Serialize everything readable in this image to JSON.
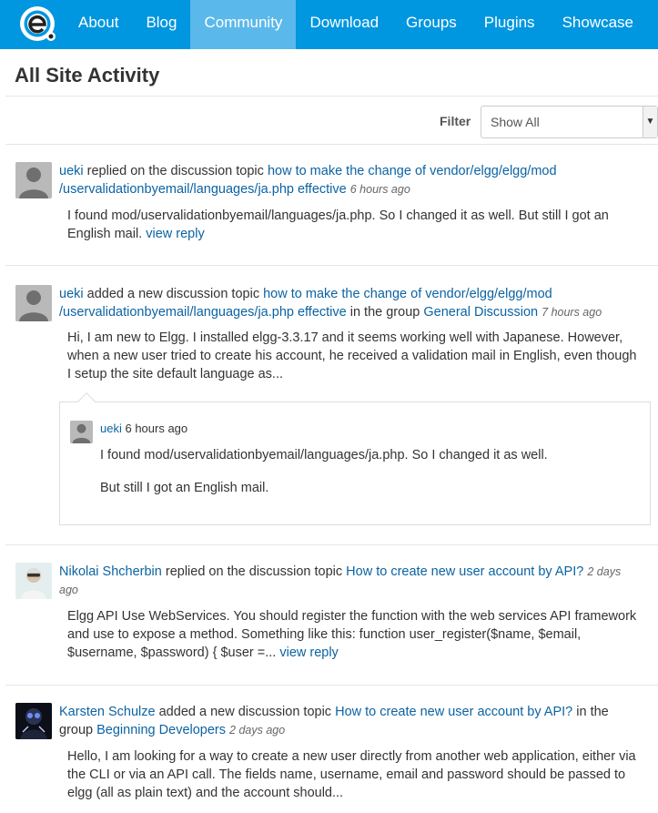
{
  "nav": {
    "items": [
      {
        "label": "About"
      },
      {
        "label": "Blog"
      },
      {
        "label": "Community",
        "active": true
      },
      {
        "label": "Download"
      },
      {
        "label": "Groups"
      },
      {
        "label": "Plugins"
      },
      {
        "label": "Showcase"
      }
    ]
  },
  "page": {
    "title": "All Site Activity"
  },
  "filter": {
    "label": "Filter",
    "selected": "Show All"
  },
  "activities": [
    {
      "user": "ueki",
      "action": " replied on the discussion topic ",
      "topic": "how to make the change of vendor/elgg/elgg/mod /uservalidationbyemail/languages/ja.php effective",
      "time": "6 hours ago",
      "excerpt": "I found mod/uservalidationbyemail/languages/ja.php. So I changed it as well. But still I got an English mail.",
      "link": "view reply"
    },
    {
      "user": "ueki",
      "action": " added a new discussion topic ",
      "topic": "how to make the change of vendor/elgg/elgg/mod /uservalidationbyemail/languages/ja.php effective",
      "in_group": " in the group ",
      "group": "General Discussion",
      "time": "7 hours ago",
      "excerpt": "Hi, I am new to Elgg. I installed elgg-3.3.17 and it seems working well with Japanese. However, when a new user tried to create his account, he received a validation mail in English, even though I setup the site default language as...",
      "reply": {
        "user": "ueki",
        "time": "6 hours ago",
        "p1": "I found mod/uservalidationbyemail/languages/ja.php. So I changed it as well.",
        "p2": "But still I got an English mail."
      }
    },
    {
      "user": "Nikolai Shcherbin",
      "action": " replied on the discussion topic ",
      "topic": "How to create new user account by API?",
      "time": "2 days ago",
      "excerpt": "Elgg API Use WebServices. You should register the function with the web services API framework and use to expose a method. Something like this: function user_register($name, $email, $username, $password) { $user =...",
      "link": "view reply"
    },
    {
      "user": "Karsten Schulze",
      "action": " added a new discussion topic ",
      "topic": "How to create new user account by API?",
      "in_group": " in the group ",
      "group": "Beginning Developers",
      "time": "2 days ago",
      "excerpt": "Hello, I am looking for a way to create a new user directly from another web application, either via the CLI or via an API call. The fields name, username, email and password should be passed to elgg (all as plain text) and the account should..."
    }
  ],
  "colors": {
    "brand": "#0096e0",
    "nav_active": "#5bb8ea",
    "link": "#0b63a3"
  },
  "icons": [
    "elgg-logo-icon",
    "chevron-down-icon",
    "default-avatar-icon"
  ]
}
